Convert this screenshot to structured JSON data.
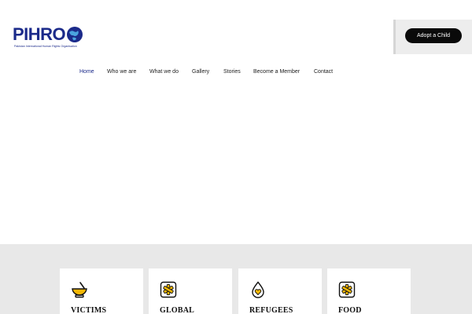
{
  "brand": {
    "logo_text": "PIHRO",
    "tagline": "Pakistan International Human Rights Organisation"
  },
  "header": {
    "cta_label": "Adopt a Child"
  },
  "nav": {
    "items": [
      {
        "label": "Home",
        "active": true
      },
      {
        "label": "Who we are"
      },
      {
        "label": "What we do"
      },
      {
        "label": "Gallery"
      },
      {
        "label": "Stories"
      },
      {
        "label": "Become a Member"
      },
      {
        "label": "Contact"
      }
    ]
  },
  "cards": [
    {
      "title": "VICTIMS",
      "icon": "mortar-pestle-icon"
    },
    {
      "title": "GLOBAL",
      "icon": "medical-star-icon"
    },
    {
      "title": "REFUGEES",
      "icon": "drop-heart-icon"
    },
    {
      "title": "FOOD",
      "icon": "medical-star-icon"
    }
  ],
  "colors": {
    "brand_blue": "#1b2a8a",
    "accent_yellow": "#f2b705",
    "button_black": "#0a0a0a",
    "band_grey": "#e8e8e8"
  }
}
